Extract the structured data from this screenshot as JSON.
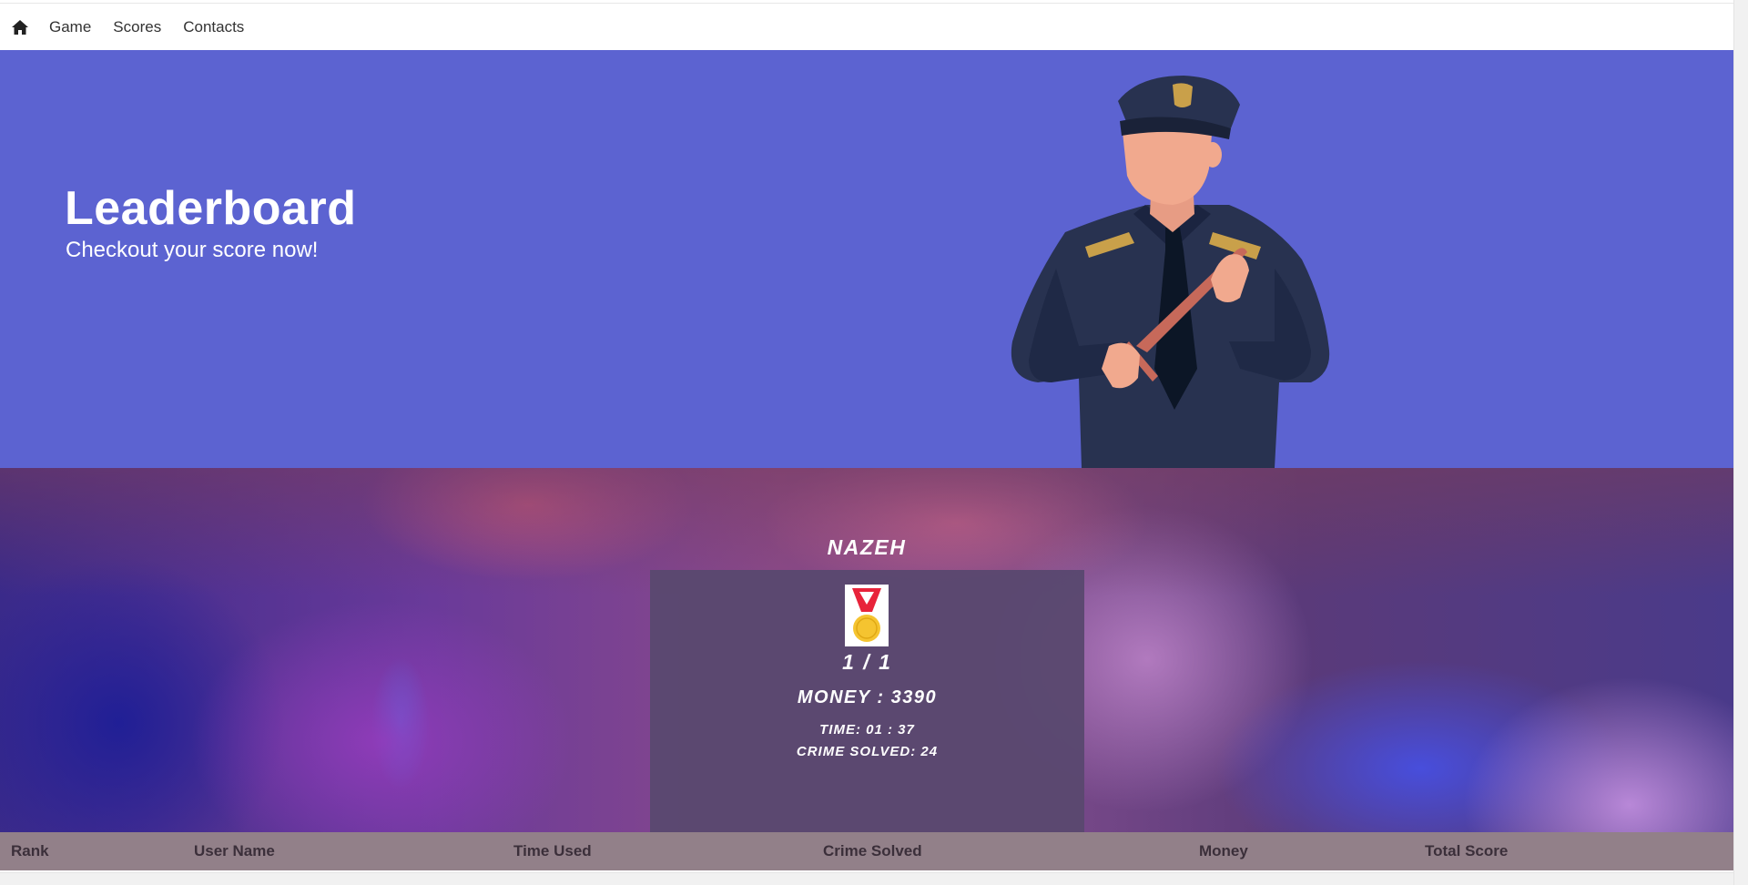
{
  "nav": {
    "home_icon": "home-icon",
    "links": [
      "Game",
      "Scores",
      "Contacts"
    ]
  },
  "hero": {
    "title": "Leaderboard",
    "subtitle": "Checkout your score now!",
    "background_color": "#5c63d1",
    "illustration": "police-officer-illustration"
  },
  "player": {
    "name": "NAZEH",
    "medal_icon": "gold-medal-icon",
    "rank": "1 / 1",
    "money": "MONEY : 3390",
    "time": "TIME: 01 : 37",
    "crime_solved": "CRIME SOLVED: 24"
  },
  "table": {
    "headers": [
      "Rank",
      "User Name",
      "Time Used",
      "Crime Solved",
      "Money",
      "Total Score"
    ],
    "header_color": "#928089"
  }
}
